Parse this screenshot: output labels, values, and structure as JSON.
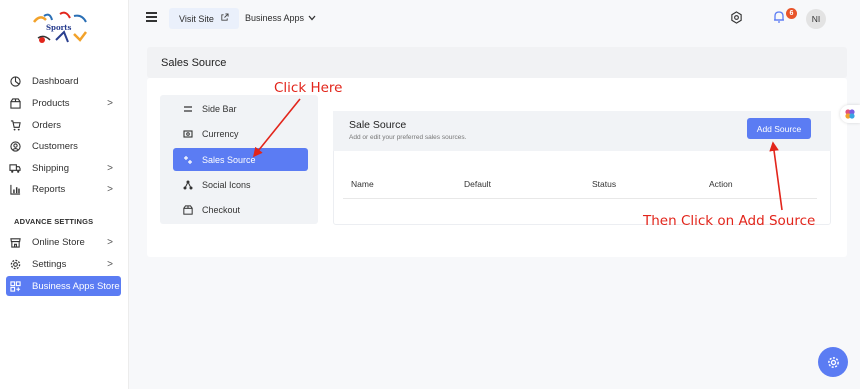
{
  "brand": {
    "logo_text": "Sports"
  },
  "sidebar": {
    "items": [
      {
        "label": "Dashboard",
        "icon": "dashboard-icon"
      },
      {
        "label": "Products",
        "icon": "box-icon",
        "chevron": ">"
      },
      {
        "label": "Orders",
        "icon": "cart-icon"
      },
      {
        "label": "Customers",
        "icon": "user-circle-icon"
      },
      {
        "label": "Shipping",
        "icon": "truck-icon",
        "chevron": ">"
      },
      {
        "label": "Reports",
        "icon": "chart-icon",
        "chevron": ">"
      }
    ],
    "section_label": "ADVANCE SETTINGS",
    "advance_items": [
      {
        "label": "Online Store",
        "icon": "store-icon",
        "chevron": ">"
      },
      {
        "label": "Settings",
        "icon": "gear-icon",
        "chevron": ">"
      },
      {
        "label": "Business Apps Store",
        "icon": "apps-icon",
        "active": true
      }
    ]
  },
  "topbar": {
    "visit_site": "Visit Site",
    "business_apps": "Business Apps",
    "notification_count": "6",
    "avatar_initials": "NI"
  },
  "page": {
    "title": "Sales Source"
  },
  "settings_menu": {
    "items": [
      {
        "label": "Side Bar",
        "icon": "bars-icon"
      },
      {
        "label": "Currency",
        "icon": "currency-icon"
      },
      {
        "label": "Sales Source",
        "icon": "sparkle-icon",
        "active": true
      },
      {
        "label": "Social Icons",
        "icon": "network-icon"
      },
      {
        "label": "Checkout",
        "icon": "box-icon"
      }
    ]
  },
  "sale_source": {
    "title": "Sale Source",
    "subtitle": "Add or edit your preferred sales sources.",
    "add_button": "Add Source",
    "columns": [
      "Name",
      "Default",
      "Status",
      "Action"
    ]
  },
  "annotations": {
    "click_here": "Click Here",
    "then_click": "Then Click on Add Source",
    "color": "#e2251b"
  },
  "colors": {
    "accent": "#5b7cf3",
    "badge": "#e8542a"
  }
}
